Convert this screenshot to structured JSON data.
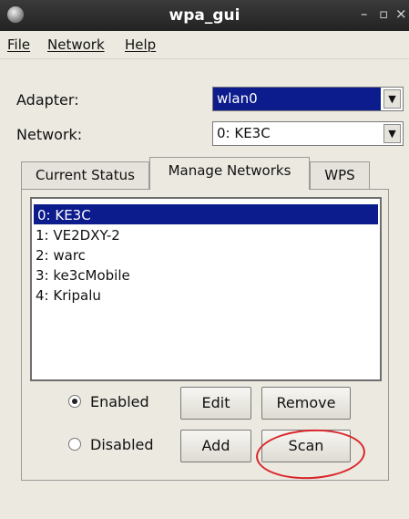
{
  "window": {
    "title": "wpa_gui",
    "minimize": "–",
    "maximize": "▫",
    "close": "×"
  },
  "menu": {
    "file": "File",
    "network": "Network",
    "help": "Help"
  },
  "adapter": {
    "label": "Adapter:",
    "value": "wlan0"
  },
  "network_select": {
    "label": "Network:",
    "value": "0: KE3C"
  },
  "tabs": [
    {
      "label": "Current Status",
      "active": false
    },
    {
      "label": "Manage Networks",
      "active": true
    },
    {
      "label": "WPS",
      "active": false
    }
  ],
  "networks": [
    "0: KE3C",
    "1: VE2DXY-2",
    "2: warc",
    "3: ke3cMobile",
    "4: Kripalu"
  ],
  "selected_network_index": 0,
  "radios": {
    "enabled": "Enabled",
    "disabled": "Disabled",
    "selected": "enabled"
  },
  "buttons": {
    "edit": "Edit",
    "remove": "Remove",
    "add": "Add",
    "scan": "Scan"
  },
  "colors": {
    "selection": "#0c1c8c",
    "annotation": "#d9262b",
    "titlebar": "#2d2d2d"
  }
}
